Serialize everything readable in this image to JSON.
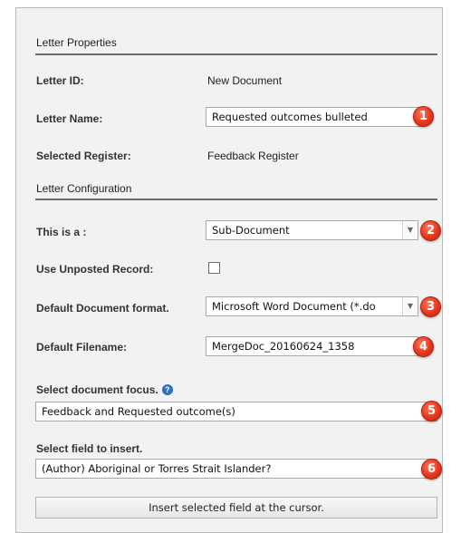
{
  "properties": {
    "heading": "Letter Properties",
    "letter_id_label": "Letter ID:",
    "letter_id_value": "New Document",
    "letter_name_label": "Letter Name:",
    "letter_name_value": "Requested outcomes bulleted",
    "selected_register_label": "Selected Register:",
    "selected_register_value": "Feedback Register"
  },
  "configuration": {
    "heading": "Letter Configuration",
    "this_is_a_label": "This is a :",
    "this_is_a_value": "Sub-Document",
    "use_unposted_label": "Use Unposted Record:",
    "use_unposted_checked": false,
    "default_format_label": "Default Document format.",
    "default_format_value": "Microsoft Word Document (*.do",
    "default_filename_label": "Default Filename:",
    "default_filename_value": "MergeDoc_20160624_1358",
    "focus_label": "Select document focus.",
    "focus_value": "Feedback and Requested outcome(s)",
    "field_label": "Select field to insert.",
    "field_value": "(Author) Aboriginal or Torres Strait Islander?",
    "insert_button": "Insert selected field at the cursor."
  },
  "badges": [
    "1",
    "2",
    "3",
    "4",
    "5",
    "6"
  ],
  "colors": {
    "badge": "#e5361d",
    "help_icon": "#2a6fc9",
    "panel": "#f2f2f2"
  }
}
